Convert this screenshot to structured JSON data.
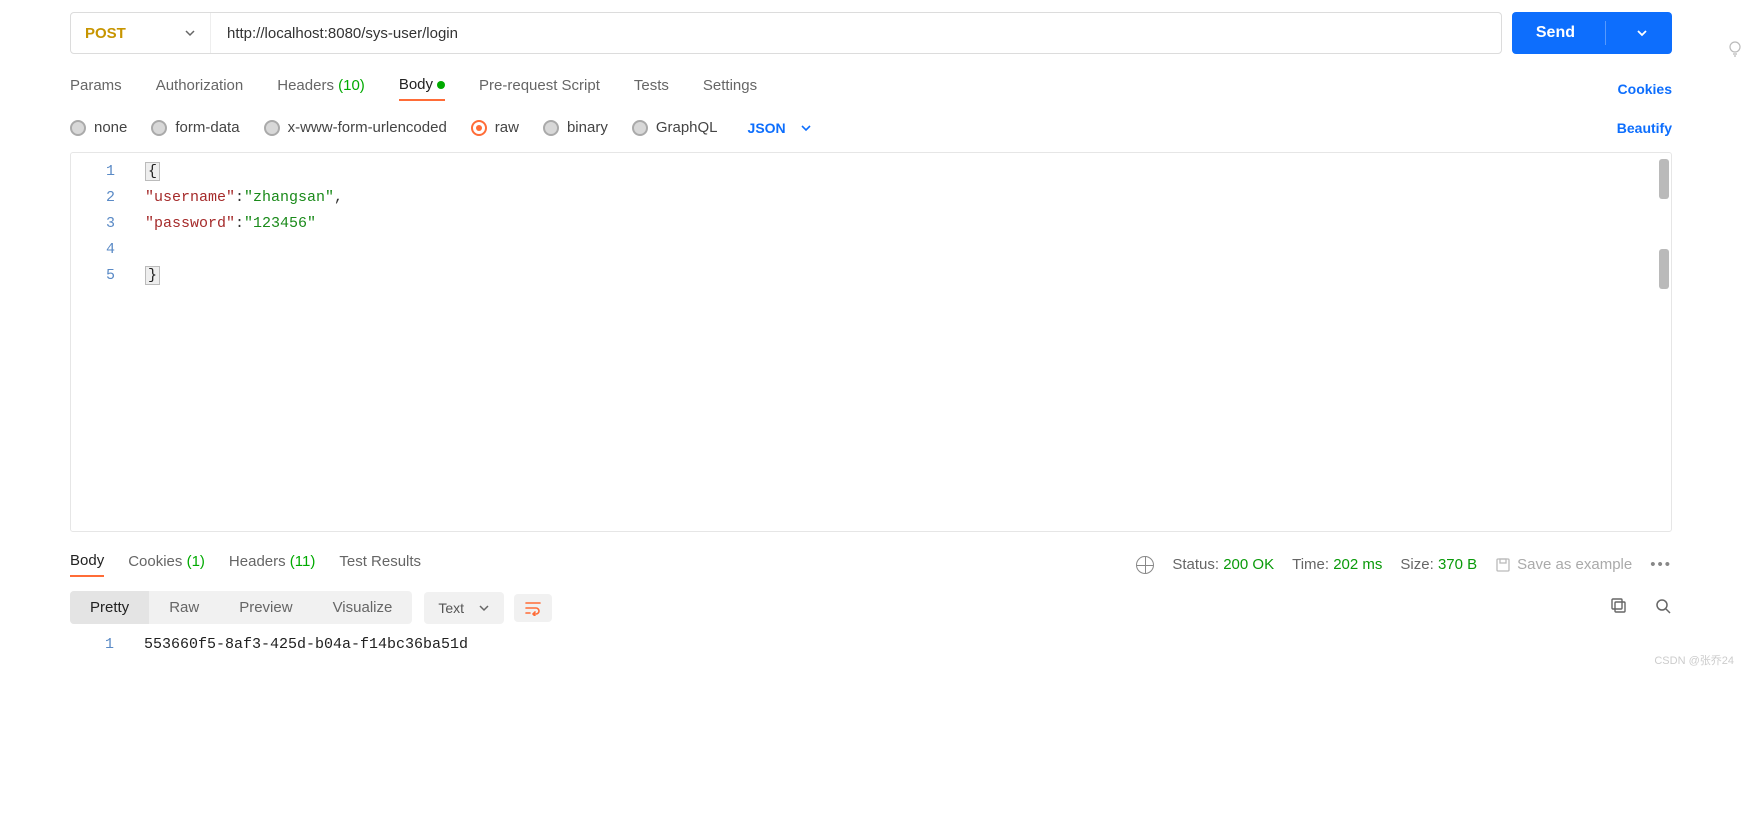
{
  "request": {
    "method": "POST",
    "url": "http://localhost:8080/sys-user/login",
    "send_label": "Send"
  },
  "tabs": {
    "params": "Params",
    "auth": "Authorization",
    "headers_label": "Headers",
    "headers_count": "(10)",
    "body": "Body",
    "prescript": "Pre-request Script",
    "tests": "Tests",
    "settings": "Settings",
    "cookies": "Cookies"
  },
  "body_types": {
    "none": "none",
    "form_data": "form-data",
    "urlencoded": "x-www-form-urlencoded",
    "raw": "raw",
    "binary": "binary",
    "graphql": "GraphQL",
    "format": "JSON",
    "beautify": "Beautify"
  },
  "editor": {
    "lines": [
      "1",
      "2",
      "3",
      "4",
      "5"
    ],
    "l1_open": "{",
    "k_user": "\"username\"",
    "v_user": "\"zhangsan\"",
    "k_pass": "\"password\"",
    "v_pass": "\"123456\"",
    "l5_close": "}"
  },
  "response": {
    "tabs": {
      "body": "Body",
      "cookies_l": "Cookies",
      "cookies_c": "(1)",
      "headers_l": "Headers",
      "headers_c": "(11)",
      "results": "Test Results"
    },
    "status_label": "Status:",
    "status_value": "200 OK",
    "time_label": "Time:",
    "time_value": "202 ms",
    "size_label": "Size:",
    "size_value": "370 B",
    "save_example": "Save as example",
    "view": {
      "pretty": "Pretty",
      "raw": "Raw",
      "preview": "Preview",
      "visualize": "Visualize",
      "text": "Text"
    },
    "lines": [
      "1"
    ],
    "body_text": "553660f5-8af3-425d-b04a-f14bc36ba51d"
  },
  "watermark": "CSDN @张乔24"
}
